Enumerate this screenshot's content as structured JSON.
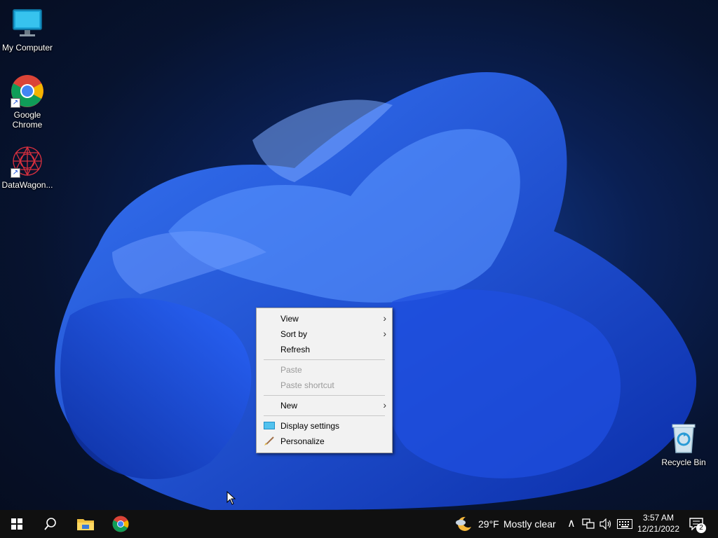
{
  "desktop": {
    "icons": [
      {
        "label": "My Computer",
        "icon": "monitor-icon"
      },
      {
        "label": "Google Chrome",
        "icon": "chrome-icon"
      },
      {
        "label": "DataWagon...",
        "icon": "datawagon-icon"
      },
      {
        "label": "Recycle Bin",
        "icon": "recycle-bin-icon"
      }
    ]
  },
  "context_menu": {
    "items": [
      {
        "label": "View",
        "submenu": true,
        "enabled": true
      },
      {
        "label": "Sort by",
        "submenu": true,
        "enabled": true
      },
      {
        "label": "Refresh",
        "submenu": false,
        "enabled": true
      },
      {
        "label": "Paste",
        "submenu": false,
        "enabled": false
      },
      {
        "label": "Paste shortcut",
        "submenu": false,
        "enabled": false
      },
      {
        "label": "New",
        "submenu": true,
        "enabled": true
      },
      {
        "label": "Display settings",
        "submenu": false,
        "enabled": true,
        "icon": "display-icon"
      },
      {
        "label": "Personalize",
        "submenu": false,
        "enabled": true,
        "icon": "paintbrush-icon"
      }
    ]
  },
  "taskbar": {
    "weather": {
      "temp": "29°F",
      "condition": "Mostly clear"
    },
    "clock": {
      "time": "3:57 AM",
      "date": "12/21/2022"
    },
    "notification_count": "2"
  },
  "colors": {
    "accent": "#1a5cff",
    "taskbar": "#101010",
    "menu_bg": "#f2f2f2"
  }
}
